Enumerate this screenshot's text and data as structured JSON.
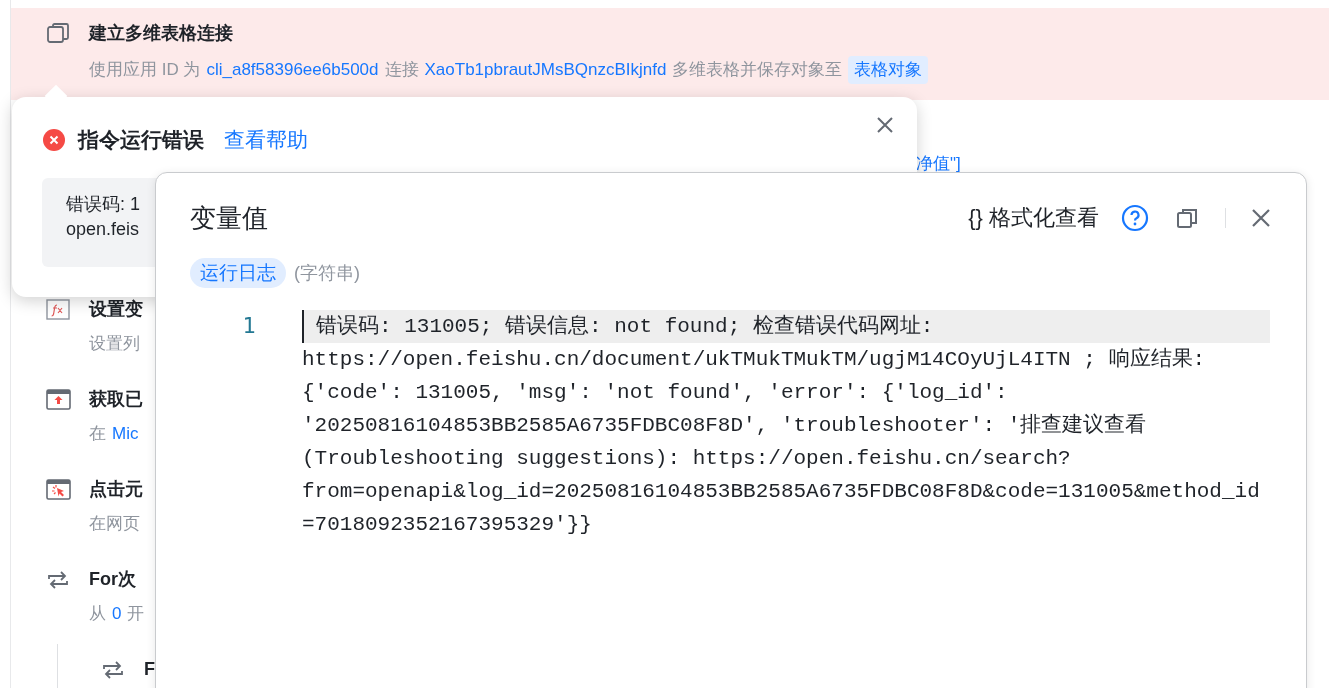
{
  "steps": [
    {
      "kind": "connect",
      "selected": true,
      "title": "建立多维表格连接",
      "description": [
        {
          "kind": "text",
          "text": "使用应用 ID 为"
        },
        {
          "kind": "value",
          "text": "cli_a8f58396ee6b500d"
        },
        {
          "kind": "text",
          "text": "连接"
        },
        {
          "kind": "value",
          "text": "XaoTb1pbrautJMsBQnzcBIkjnfd"
        },
        {
          "kind": "text",
          "text": "多维表格并保存对象至"
        },
        {
          "kind": "tag",
          "text": "表格对象"
        }
      ]
    },
    {
      "kind": "covered",
      "fragment": "净值\"]"
    },
    {
      "kind": "variable",
      "selected": false,
      "title": "设置变",
      "description": [
        {
          "kind": "text",
          "text": "设置列"
        }
      ]
    },
    {
      "kind": "browser_upload",
      "selected": false,
      "title": "获取已",
      "description": [
        {
          "kind": "text",
          "text": "在"
        },
        {
          "kind": "value",
          "text": "Mic"
        }
      ]
    },
    {
      "kind": "browser_click",
      "selected": false,
      "title": "点击元",
      "description": [
        {
          "kind": "text",
          "text": "在网页"
        }
      ]
    },
    {
      "kind": "loop",
      "selected": false,
      "title": "For次",
      "description": [
        {
          "kind": "text",
          "text": "从"
        },
        {
          "kind": "value",
          "text": "0"
        },
        {
          "kind": "text",
          "text": "开"
        }
      ],
      "children": [
        {
          "kind": "loop",
          "selected": false,
          "title": "F"
        }
      ]
    }
  ],
  "error_popup": {
    "title": "指令运行错误",
    "help_link": "查看帮助",
    "message_lines": [
      "错误码: 1",
      "open.feis"
    ]
  },
  "dialog": {
    "title": "变量值",
    "format_button": "{} 格式化查看",
    "variable_tag": "运行日志",
    "variable_type": "(字符串)",
    "code_lines": [
      {
        "number": "1",
        "current": true,
        "text": "错误码: 131005; 错误信息: not found; 检查错误代码网址: https://open.feishu.cn/document/ukTMukTMukTM/ugjM14COyUjL4ITN ; 响应结果: {'code': 131005, 'msg': 'not found', 'error': {'log_id': '20250816104853BB2585A6735FDBC08F8D', 'troubleshooter': '排查建议查看(Troubleshooting suggestions): https://open.feishu.cn/search?from=openapi&log_id=20250816104853BB2585A6735FDBC08F8D&code=131005&method_id=7018092352167395329'}}"
      }
    ]
  }
}
